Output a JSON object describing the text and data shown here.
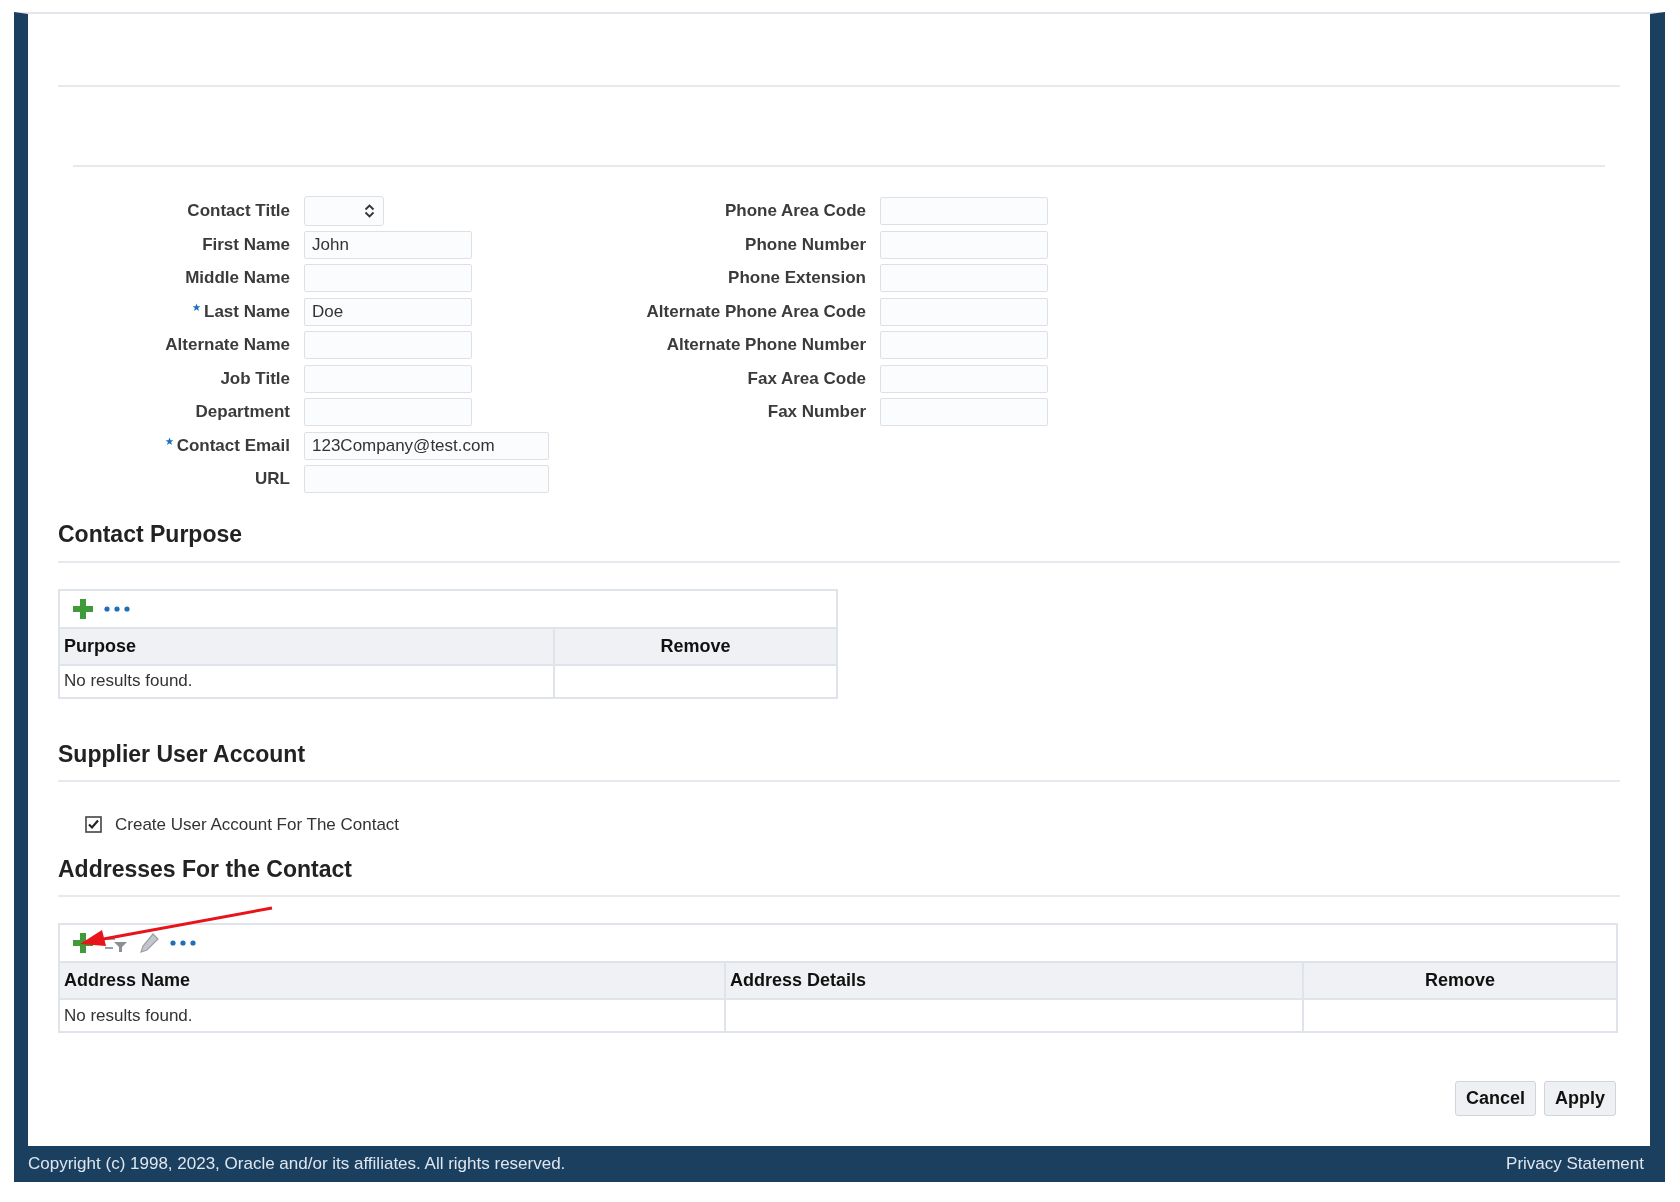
{
  "form": {
    "left_fields": [
      {
        "label": "Contact Title",
        "kind": "select",
        "required": false
      },
      {
        "label": "First Name",
        "kind": "text",
        "value": "John",
        "required": false
      },
      {
        "label": "Middle Name",
        "kind": "text",
        "required": false
      },
      {
        "label": "Last Name",
        "kind": "text",
        "value": "Doe",
        "required": true
      },
      {
        "label": "Alternate Name",
        "kind": "text",
        "required": false
      },
      {
        "label": "Job Title",
        "kind": "text",
        "required": false
      },
      {
        "label": "Department",
        "kind": "text",
        "required": false
      },
      {
        "label": "Contact Email",
        "kind": "wide",
        "value": "123Company@test.com",
        "required": true
      },
      {
        "label": "URL",
        "kind": "wide",
        "required": false
      }
    ],
    "right_fields": [
      {
        "label": "Phone Area Code",
        "kind": "text",
        "required": false
      },
      {
        "label": "Phone Number",
        "kind": "text",
        "required": false
      },
      {
        "label": "Phone Extension",
        "kind": "text",
        "required": false
      },
      {
        "label": "Alternate Phone Area Code",
        "kind": "text",
        "required": false
      },
      {
        "label": "Alternate Phone Number",
        "kind": "text",
        "required": false
      },
      {
        "label": "Fax Area Code",
        "kind": "text",
        "required": false
      },
      {
        "label": "Fax Number",
        "kind": "text",
        "required": false
      }
    ]
  },
  "contact_purpose": {
    "title": "Contact Purpose",
    "columns": [
      "Purpose",
      "Remove"
    ],
    "empty_message": "No results found."
  },
  "supplier_user_account": {
    "title": "Supplier User Account",
    "checkbox": {
      "label": "Create User Account For The Contact",
      "checked": true
    }
  },
  "addresses": {
    "title": "Addresses For the Contact",
    "columns": [
      "Address Name",
      "Address Details",
      "Remove"
    ],
    "empty_message": "No results found."
  },
  "buttons": [
    "Cancel",
    "Apply"
  ],
  "footer": {
    "copyright": "Copyright (c) 1998, 2023, Oracle and/or its affiliates. All rights reserved.",
    "privacy_link": "Privacy Statement"
  }
}
